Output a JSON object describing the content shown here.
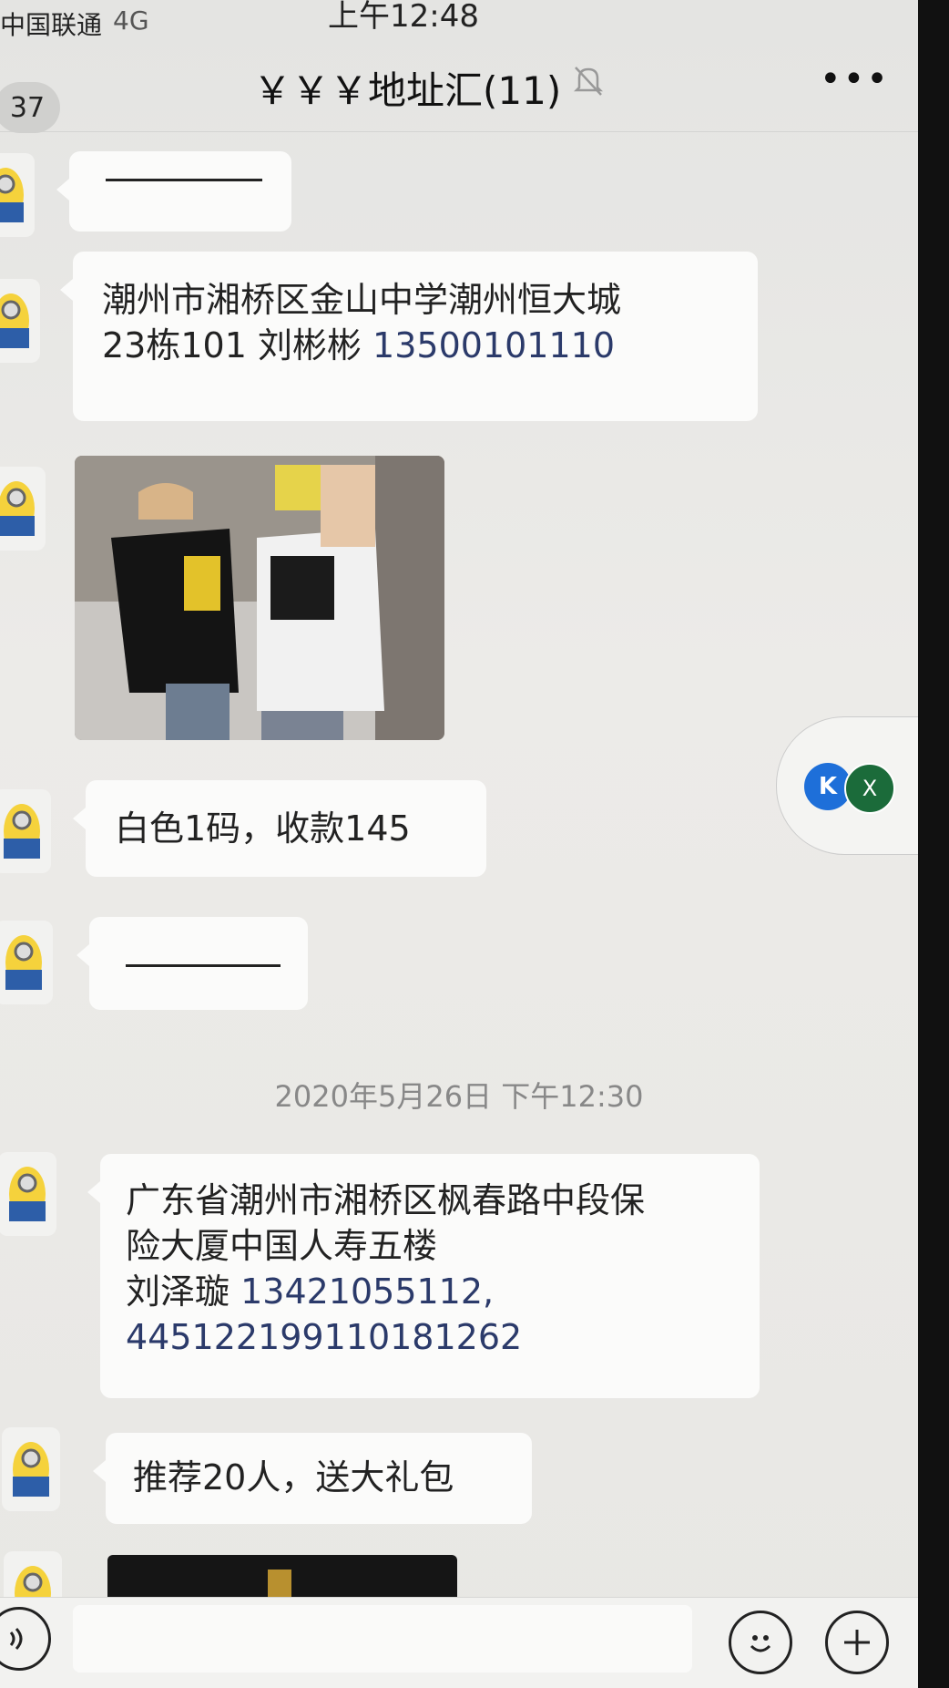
{
  "status_bar": {
    "carrier": "中国联通",
    "network": "4G",
    "time": "上午12:48"
  },
  "nav": {
    "back_count": "37",
    "title": "￥￥￥地址汇(11)",
    "more": "•••"
  },
  "messages": [
    {
      "type": "dash"
    },
    {
      "type": "text",
      "lines": [
        "潮州市湘桥区金山中学潮州恒大城",
        "23栋101 刘彬彬 "
      ],
      "phone": "13500101110"
    },
    {
      "type": "image"
    },
    {
      "type": "text",
      "lines": [
        "白色1码，收款145"
      ]
    },
    {
      "type": "dash"
    },
    {
      "type": "text",
      "lines": [
        "广东省潮州市湘桥区枫春路中段保",
        "险大厦中国人寿五楼",
        "刘泽璇  "
      ],
      "phone": "13421055112,",
      "id": "445122199110181262"
    },
    {
      "type": "text",
      "lines": [
        "推荐20人，送大礼包"
      ]
    },
    {
      "type": "image"
    }
  ],
  "timestamp": "2020年5月26日 下午12:30",
  "floating_widget": {
    "icon_k": "K",
    "icon_x": "X"
  },
  "input_bar": {
    "voice_icon": "voice-icon",
    "emoji_icon": "emoji-icon",
    "plus_icon": "plus-icon"
  }
}
